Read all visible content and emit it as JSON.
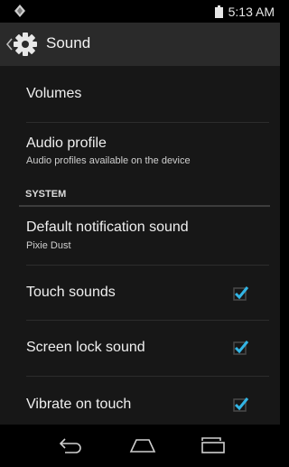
{
  "status_bar": {
    "time": "5:13 AM"
  },
  "action_bar": {
    "title": "Sound",
    "icon": "gear-icon"
  },
  "list": {
    "volumes": {
      "title": "Volumes"
    },
    "audio_profile": {
      "title": "Audio profile",
      "summary": "Audio profiles available on the device"
    },
    "section_system": "SYSTEM",
    "default_notification": {
      "title": "Default notification sound",
      "summary": "Pixie Dust"
    },
    "touch_sounds": {
      "title": "Touch sounds",
      "checked": true
    },
    "screen_lock_sound": {
      "title": "Screen lock sound",
      "checked": true
    },
    "vibrate_on_touch": {
      "title": "Vibrate on touch",
      "checked": true
    }
  },
  "nav_bar": {
    "back": "back-icon",
    "home": "home-icon",
    "recents": "recents-icon"
  },
  "colors": {
    "accent": "#33b5e5",
    "background": "#171717",
    "action_bar": "#2a2a2a"
  }
}
